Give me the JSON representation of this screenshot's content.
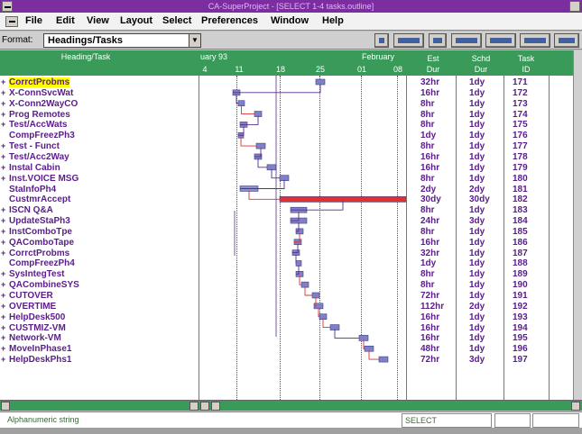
{
  "window": {
    "title": "CA-SuperProject - [SELECT 1-4 tasks.outline]"
  },
  "menu": [
    {
      "label": "File",
      "key": "file"
    },
    {
      "label": "Edit",
      "key": "edit"
    },
    {
      "label": "View",
      "key": "view"
    },
    {
      "label": "Layout",
      "key": "layout"
    },
    {
      "label": "Select",
      "key": "select"
    },
    {
      "label": "Preferences",
      "key": "preferences"
    },
    {
      "label": "Window",
      "key": "window"
    },
    {
      "label": "Help",
      "key": "help"
    }
  ],
  "toolbar": {
    "format_label": "Format:",
    "format_value": "Headings/Tasks"
  },
  "header": {
    "name": "Heading/Task",
    "months": "uary 93",
    "feb": "February",
    "days": [
      "4",
      "11",
      "18",
      "25",
      "01",
      "08"
    ],
    "est_line1": "Est",
    "est_line2": "Dur",
    "sched_line1": "Schd",
    "sched_line2": "Dur",
    "task_line1": "Task",
    "task_line2": "ID"
  },
  "rows": [
    {
      "name": "CorrctProbms",
      "plus": "+",
      "est": "32hr",
      "sched": "1dy",
      "id": "171"
    },
    {
      "name": "X-ConnSvcWat",
      "plus": "+",
      "est": "16hr",
      "sched": "1dy",
      "id": "172"
    },
    {
      "name": "X-Conn2WayCO",
      "plus": "+",
      "est": "8hr",
      "sched": "1dy",
      "id": "173"
    },
    {
      "name": "Prog Remotes",
      "plus": "+",
      "est": "8hr",
      "sched": "1dy",
      "id": "174"
    },
    {
      "name": "Test/AccWats",
      "plus": "+",
      "est": "8hr",
      "sched": "1dy",
      "id": "175"
    },
    {
      "name": "CompFreezPh3",
      "plus": "",
      "est": "1dy",
      "sched": "1dy",
      "id": "176"
    },
    {
      "name": "Test - Funct",
      "plus": "+",
      "est": "8hr",
      "sched": "1dy",
      "id": "177"
    },
    {
      "name": "Test/Acc2Way",
      "plus": "+",
      "est": "16hr",
      "sched": "1dy",
      "id": "178"
    },
    {
      "name": "Instal Cabin",
      "plus": "+",
      "est": "16hr",
      "sched": "1dy",
      "id": "179"
    },
    {
      "name": "Inst.VOICE MSG",
      "plus": "+",
      "est": "8hr",
      "sched": "1dy",
      "id": "180"
    },
    {
      "name": "StaInfoPh4",
      "plus": "",
      "est": "2dy",
      "sched": "2dy",
      "id": "181"
    },
    {
      "name": "CustmrAccept",
      "plus": "",
      "est": "30dy",
      "sched": "30dy",
      "id": "182"
    },
    {
      "name": "ISCN Q&A",
      "plus": "+",
      "est": "8hr",
      "sched": "1dy",
      "id": "183"
    },
    {
      "name": "UpdateStaPh3",
      "plus": "+",
      "est": "24hr",
      "sched": "3dy",
      "id": "184"
    },
    {
      "name": "InstComboTpe",
      "plus": "+",
      "est": "8hr",
      "sched": "1dy",
      "id": "185"
    },
    {
      "name": "QAComboTape",
      "plus": "+",
      "est": "16hr",
      "sched": "1dy",
      "id": "186"
    },
    {
      "name": "CorrctProbms",
      "plus": "+",
      "est": "32hr",
      "sched": "1dy",
      "id": "187"
    },
    {
      "name": "CompFreezPh4",
      "plus": "",
      "est": "1dy",
      "sched": "1dy",
      "id": "188"
    },
    {
      "name": "SysIntegTest",
      "plus": "+",
      "est": "8hr",
      "sched": "1dy",
      "id": "189"
    },
    {
      "name": "QACombineSYS",
      "plus": "+",
      "est": "8hr",
      "sched": "1dy",
      "id": "190"
    },
    {
      "name": "CUTOVER",
      "plus": "+",
      "est": "72hr",
      "sched": "1dy",
      "id": "191"
    },
    {
      "name": "OVERTIME",
      "plus": "+",
      "est": "112hr",
      "sched": "2dy",
      "id": "192"
    },
    {
      "name": "HelpDesk500",
      "plus": "+",
      "est": "16hr",
      "sched": "1dy",
      "id": "193"
    },
    {
      "name": "CUSTMIZ-VM",
      "plus": "+",
      "est": "16hr",
      "sched": "1dy",
      "id": "194"
    },
    {
      "name": "Network-VM",
      "plus": "+",
      "est": "16hr",
      "sched": "1dy",
      "id": "195"
    },
    {
      "name": "MoveInPhase1",
      "plus": "+",
      "est": "48hr",
      "sched": "1dy",
      "id": "196"
    },
    {
      "name": "HelpDeskPhs1",
      "plus": "+",
      "est": "72hr",
      "sched": "3dy",
      "id": "197"
    }
  ],
  "status": {
    "hint": "Alphanumeric string",
    "mode": "SELECT"
  },
  "colors": {
    "header": "#3a9a5a",
    "text": "#5a1c8c",
    "critical": "#e03030",
    "bar": "#7070c0",
    "selection": "#ffff00"
  }
}
